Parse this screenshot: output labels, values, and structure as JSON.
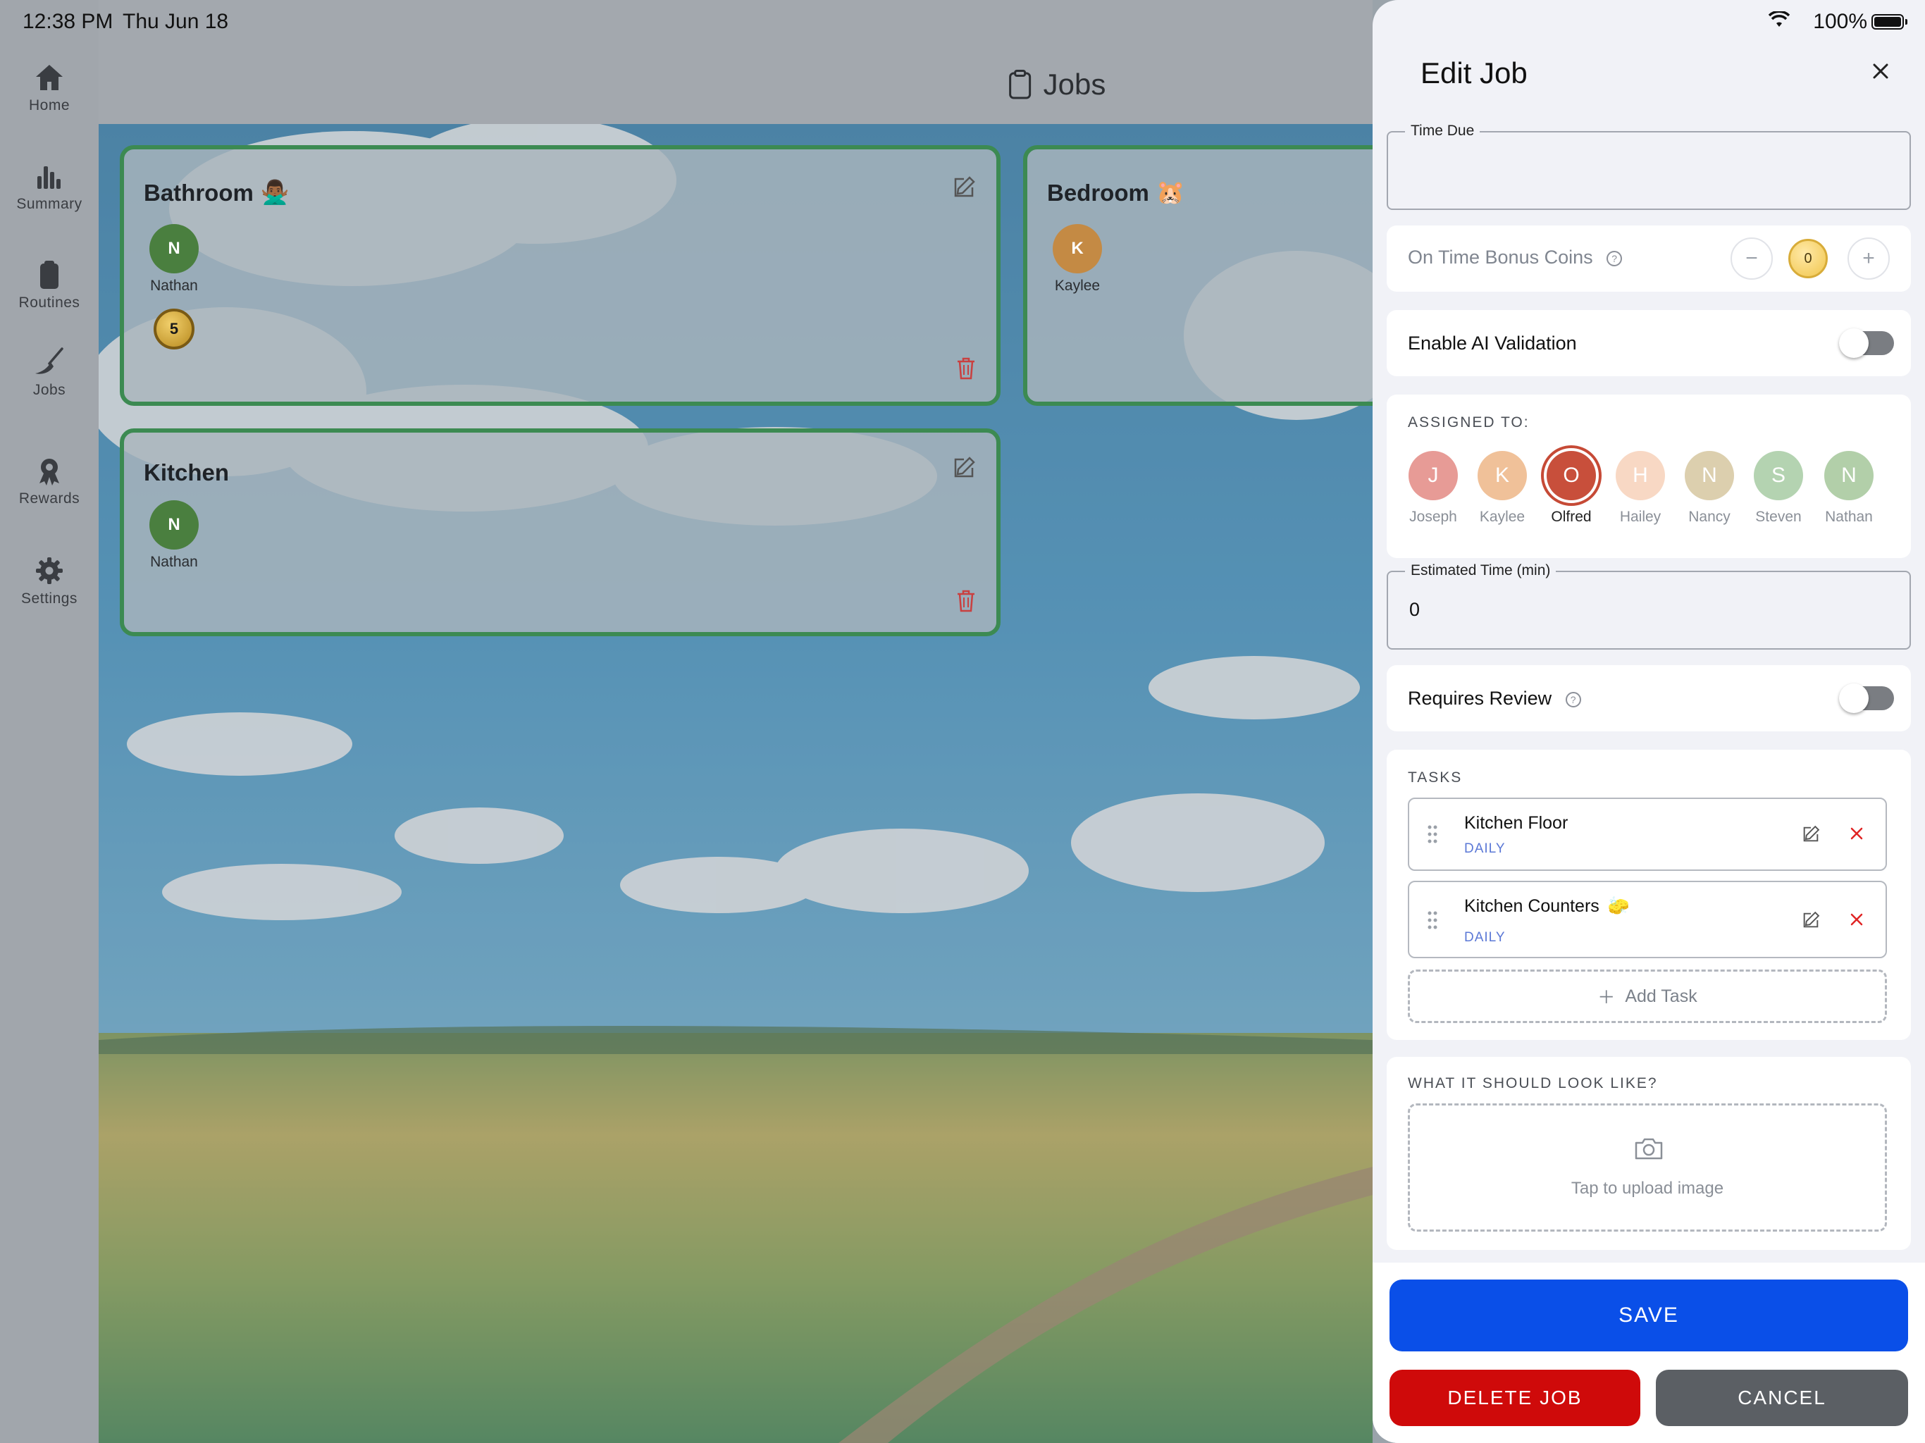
{
  "status_bar": {
    "time": "12:38 PM",
    "date": "Thu Jun 18",
    "battery": "100%"
  },
  "sidebar": {
    "items": [
      {
        "label": "Home",
        "icon": "home-icon"
      },
      {
        "label": "Summary",
        "icon": "bar-chart-icon"
      },
      {
        "label": "Routines",
        "icon": "clipboard-icon"
      },
      {
        "label": "Jobs",
        "icon": "broom-icon"
      },
      {
        "label": "Rewards",
        "icon": "award-icon"
      },
      {
        "label": "Settings",
        "icon": "gear-icon"
      }
    ]
  },
  "header": {
    "title": "Jobs"
  },
  "jobs": [
    {
      "title": "Bathroom",
      "emoji": "🙅🏾‍♂️",
      "assignees": [
        {
          "initial": "N",
          "name": "Nathan"
        }
      ],
      "bonus_coins": "5"
    },
    {
      "title": "Bedroom",
      "emoji": "🐹",
      "assignees": [
        {
          "initial": "K",
          "name": "Kaylee"
        }
      ]
    },
    {
      "title": "Kitchen",
      "emoji": "",
      "assignees": [
        {
          "initial": "N",
          "name": "Nathan"
        }
      ]
    }
  ],
  "modal": {
    "title": "Edit Job",
    "time_due": {
      "label": "Time Due",
      "value": ""
    },
    "on_time_bonus": {
      "label": "On Time Bonus Coins",
      "value": "0",
      "help": "?"
    },
    "ai_validation": {
      "label": "Enable AI Validation",
      "enabled": false
    },
    "assigned": {
      "label": "ASSIGNED TO:",
      "people": [
        {
          "initial": "J",
          "name": "Joseph",
          "color": "#e79b96",
          "selected": false
        },
        {
          "initial": "K",
          "name": "Kaylee",
          "color": "#f0c199",
          "selected": false
        },
        {
          "initial": "O",
          "name": "Olfred",
          "color": "#c84f3b",
          "selected": true
        },
        {
          "initial": "H",
          "name": "Hailey",
          "color": "#f8d8c4",
          "selected": false
        },
        {
          "initial": "N",
          "name": "Nancy",
          "color": "#dccfae",
          "selected": false
        },
        {
          "initial": "S",
          "name": "Steven",
          "color": "#b4d3b1",
          "selected": false
        },
        {
          "initial": "N",
          "name": "Nathan",
          "color": "#b2cfa9",
          "selected": false
        }
      ]
    },
    "estimated_time": {
      "label": "Estimated Time (min)",
      "value": "0"
    },
    "requires_review": {
      "label": "Requires Review",
      "enabled": false,
      "help": "?"
    },
    "tasks": {
      "label": "TASKS",
      "items": [
        {
          "name": "Kitchen Floor",
          "emoji": "",
          "frequency": "DAILY"
        },
        {
          "name": "Kitchen Counters",
          "emoji": "🧽",
          "frequency": "DAILY"
        }
      ],
      "add_label": "Add Task"
    },
    "look_like": {
      "label": "WHAT IT SHOULD LOOK LIKE?",
      "upload_hint": "Tap to upload image"
    },
    "buttons": {
      "save": "SAVE",
      "delete": "DELETE JOB",
      "cancel": "CANCEL"
    }
  },
  "colors": {
    "card_border": "#3c8a52",
    "save": "#0a4fe8",
    "delete": "#cf0a0a",
    "cancel": "#5b5f64"
  }
}
